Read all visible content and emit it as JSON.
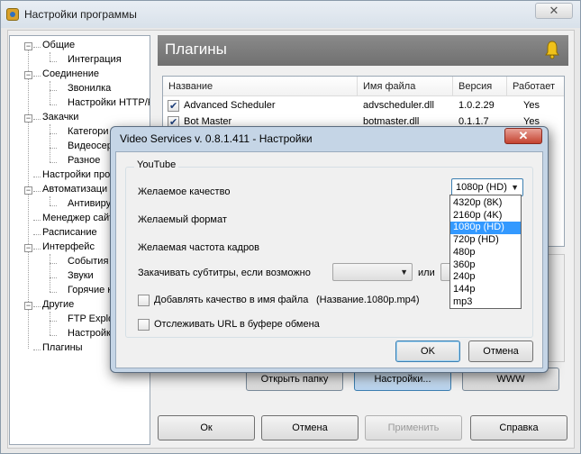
{
  "window": {
    "title": "Настройки программы",
    "close_glyph": "✕"
  },
  "tree": {
    "items": [
      {
        "label": "Общие",
        "level": 0,
        "expander": "−"
      },
      {
        "label": "Интеграция",
        "level": 1
      },
      {
        "label": "Соединение",
        "level": 0,
        "expander": "−"
      },
      {
        "label": "Звонилка",
        "level": 1
      },
      {
        "label": "Настройки HTTP/F",
        "level": 1
      },
      {
        "label": "Закачки",
        "level": 0,
        "expander": "−"
      },
      {
        "label": "Категори",
        "level": 1
      },
      {
        "label": "Видеосер",
        "level": 1
      },
      {
        "label": "Разное",
        "level": 1
      },
      {
        "label": "Настройки прогр",
        "level": 0
      },
      {
        "label": "Автоматизаци",
        "level": 0,
        "expander": "−"
      },
      {
        "label": "Антивиру",
        "level": 1
      },
      {
        "label": "Менеджер сайт",
        "level": 0
      },
      {
        "label": "Расписание",
        "level": 0
      },
      {
        "label": "Интерфейс",
        "level": 0,
        "expander": "−"
      },
      {
        "label": "События",
        "level": 1
      },
      {
        "label": "Звуки",
        "level": 1
      },
      {
        "label": "Горячие к",
        "level": 1
      },
      {
        "label": "Другие",
        "level": 0,
        "expander": "−"
      },
      {
        "label": "FTP Explor",
        "level": 1
      },
      {
        "label": "Настройк",
        "level": 1
      },
      {
        "label": "Плагины",
        "level": 0
      }
    ]
  },
  "panel": {
    "title": "Плагины",
    "columns": [
      "Название",
      "Имя файла",
      "Версия",
      "Работает"
    ],
    "rows": [
      {
        "name": "Advanced Scheduler",
        "file": "advscheduler.dll",
        "version": "1.0.2.29",
        "works": "Yes",
        "checked": true
      },
      {
        "name": "Bot Master",
        "file": "botmaster.dll",
        "version": "0.1.1.7",
        "works": "Yes",
        "checked": true
      }
    ],
    "mid_buttons": [
      "Открыть папку",
      "Настройки...",
      "WWW"
    ]
  },
  "bottom_buttons": {
    "ok": "Ок",
    "cancel": "Отмена",
    "apply": "Применить",
    "help": "Справка"
  },
  "dialog": {
    "title": "Video Services v. 0.8.1.411 - Настройки",
    "close_glyph": "✕",
    "group": "YouTube",
    "quality_label": "Желаемое качество",
    "quality_value": "1080p (HD)",
    "format_label": "Желаемый формат",
    "fps_label": "Желаемая частота кадров",
    "subs_label": "Закачивать субтитры, если возможно",
    "subs_or": "или",
    "add_quality_label": "Добавлять качество в имя файла",
    "add_quality_example": "(Название.1080p.mp4)",
    "watch_clipboard_label": "Отслеживать URL в буфере обмена",
    "ok": "OK",
    "cancel": "Отмена",
    "quality_options": [
      "4320p (8K)",
      "2160p (4K)",
      "1080p (HD)",
      "720p (HD)",
      "480p",
      "360p",
      "240p",
      "144p",
      "mp3"
    ],
    "selected_index": 2
  }
}
